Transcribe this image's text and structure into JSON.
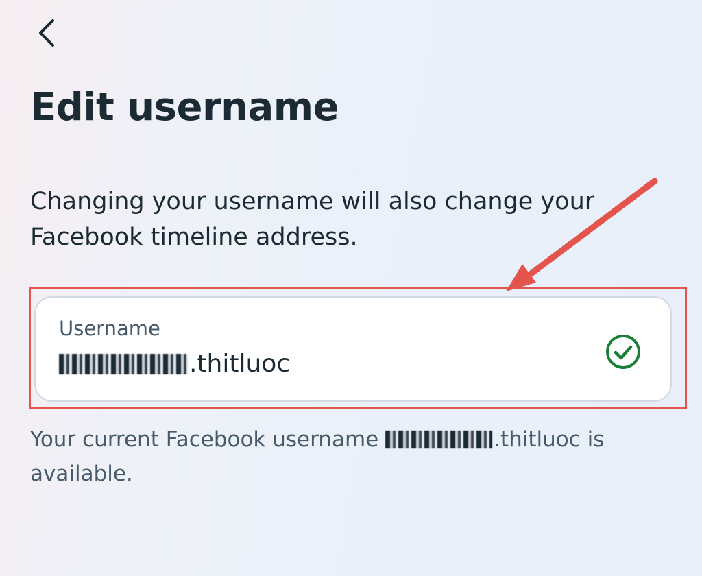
{
  "header": {
    "back_icon": "chevron-left-icon"
  },
  "page": {
    "title": "Edit username",
    "description": "Changing your username will also change your Facebook timeline address."
  },
  "field": {
    "label": "Username",
    "value_suffix": ".thitluoc",
    "status_icon": "check-circle-icon",
    "status_color": "#1a7f37"
  },
  "helper": {
    "prefix": "Your current Facebook username ",
    "suffix": ".thitluoc is available."
  },
  "annotation": {
    "color": "#e4544c"
  }
}
